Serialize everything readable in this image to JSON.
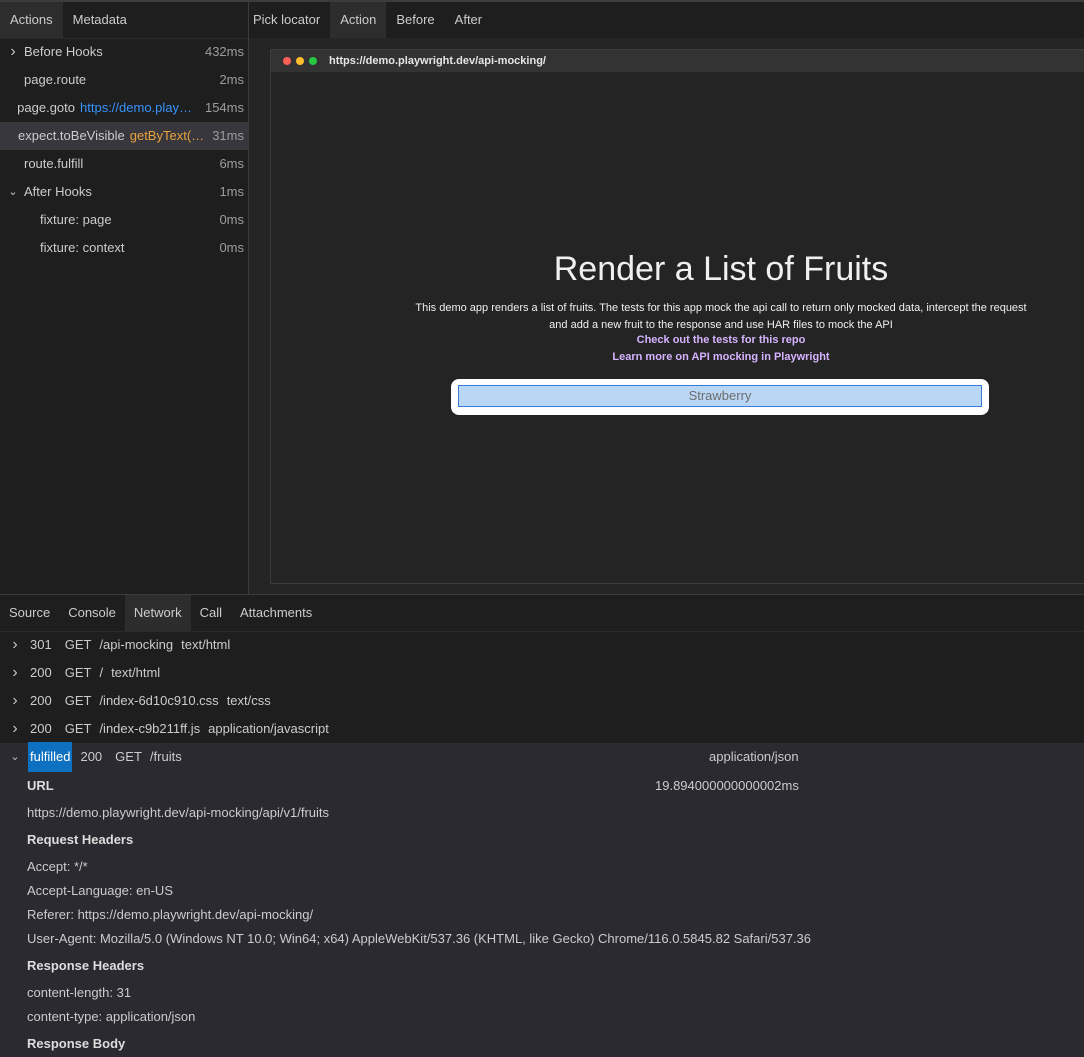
{
  "left_tabs": [
    "Actions",
    "Metadata"
  ],
  "actions": [
    {
      "chevron": "right",
      "name": "Before Hooks",
      "param": "",
      "time": "432ms",
      "indent": 0
    },
    {
      "chevron": "",
      "name": "page.route",
      "param": "",
      "time": "2ms",
      "indent": 0
    },
    {
      "chevron": "",
      "name": "page.goto",
      "param": "https://demo.playwright.dev/api-mocking",
      "time": "154ms",
      "indent": 0
    },
    {
      "chevron": "",
      "name": "expect.toBeVisible",
      "param": "getByText('Strawberry')",
      "time": "31ms",
      "indent": 0,
      "selected": true
    },
    {
      "chevron": "",
      "name": "route.fulfill",
      "param": "",
      "time": "6ms",
      "indent": 0
    },
    {
      "chevron": "down",
      "name": "After Hooks",
      "param": "",
      "time": "1ms",
      "indent": 0
    },
    {
      "chevron": "",
      "name": "fixture: page",
      "param": "",
      "time": "0ms",
      "indent": 1
    },
    {
      "chevron": "",
      "name": "fixture: context",
      "param": "",
      "time": "0ms",
      "indent": 1
    }
  ],
  "snapshot_tabs": {
    "pick": "Pick locator",
    "tabs": [
      "Action",
      "Before",
      "After"
    ]
  },
  "browser": {
    "url": "https://demo.playwright.dev/api-mocking/",
    "heading": "Render a List of Fruits",
    "description_1": "This demo app renders a list of fruits. The tests for this app mock the api call to return only mocked data, intercept the request",
    "description_2": "and add a new fruit to the response and use HAR files to mock the API",
    "link_1": "Check out the tests for this repo",
    "link_2": "Learn more on API mocking in Playwright",
    "list_item": "Strawberry"
  },
  "bottom_tabs": [
    "Source",
    "Console",
    "Network",
    "Call",
    "Attachments"
  ],
  "network": [
    {
      "status": "301",
      "method": "GET",
      "path": "/api-mocking",
      "type": "text/html"
    },
    {
      "status": "200",
      "method": "GET",
      "path": "/",
      "type": "text/html"
    },
    {
      "status": "200",
      "method": "GET",
      "path": "/index-6d10c910.css",
      "type": "text/css"
    },
    {
      "status": "200",
      "method": "GET",
      "path": "/index-c9b211ff.js",
      "type": "application/javascript"
    }
  ],
  "fulfilled": {
    "badge": "fulfilled",
    "status": "200",
    "method": "GET",
    "path": "/fruits",
    "type": "application/json",
    "url_label": "URL",
    "duration": "19.894000000000002ms",
    "url": "https://demo.playwright.dev/api-mocking/api/v1/fruits",
    "req_headers_label": "Request Headers",
    "req_headers": [
      "Accept: */*",
      "Accept-Language: en-US",
      "Referer: https://demo.playwright.dev/api-mocking/",
      "User-Agent: Mozilla/5.0 (Windows NT 10.0; Win64; x64) AppleWebKit/537.36 (KHTML, like Gecko) Chrome/116.0.5845.82 Safari/537.36"
    ],
    "resp_headers_label": "Response Headers",
    "resp_headers": [
      "content-length: 31",
      "content-type: application/json"
    ],
    "resp_body_label": "Response Body"
  },
  "colors": {
    "link": "#3794ff",
    "locator": "#e9a23b",
    "selection": "#37373d",
    "badge": "#0e70c0"
  }
}
